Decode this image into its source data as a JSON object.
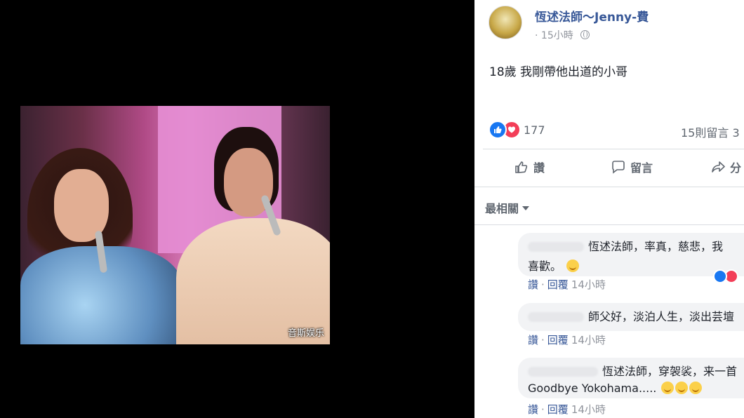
{
  "photo": {
    "watermark": "音斯娱乐"
  },
  "post": {
    "author": "恆述法師～Jenny-費",
    "time": "15小時",
    "text": "18歲 我剛帶他出道的小哥",
    "reaction_count": "177",
    "comment_count": "15則留言 3"
  },
  "actions": {
    "like": "讚",
    "comment": "留言",
    "share": "分"
  },
  "sort": {
    "label": "最相關"
  },
  "comments": [
    {
      "line1": "恆述法師，率真，慈悲，我",
      "line2": "喜歡。",
      "like": "讚",
      "reply": "回覆",
      "time": "14小時"
    },
    {
      "line1": "師父好，淡泊人生，淡出芸壇",
      "like": "讚",
      "reply": "回覆",
      "time": "14小時"
    },
    {
      "line1": "恆述法師，穿袈裟，来一首",
      "line2": "Goodbye Yokohama.....",
      "like": "讚",
      "reply": "回覆",
      "time": "14小時"
    }
  ],
  "colors": {
    "link": "#385898",
    "like_blue": "#1877f2",
    "love_red": "#f33e58"
  }
}
